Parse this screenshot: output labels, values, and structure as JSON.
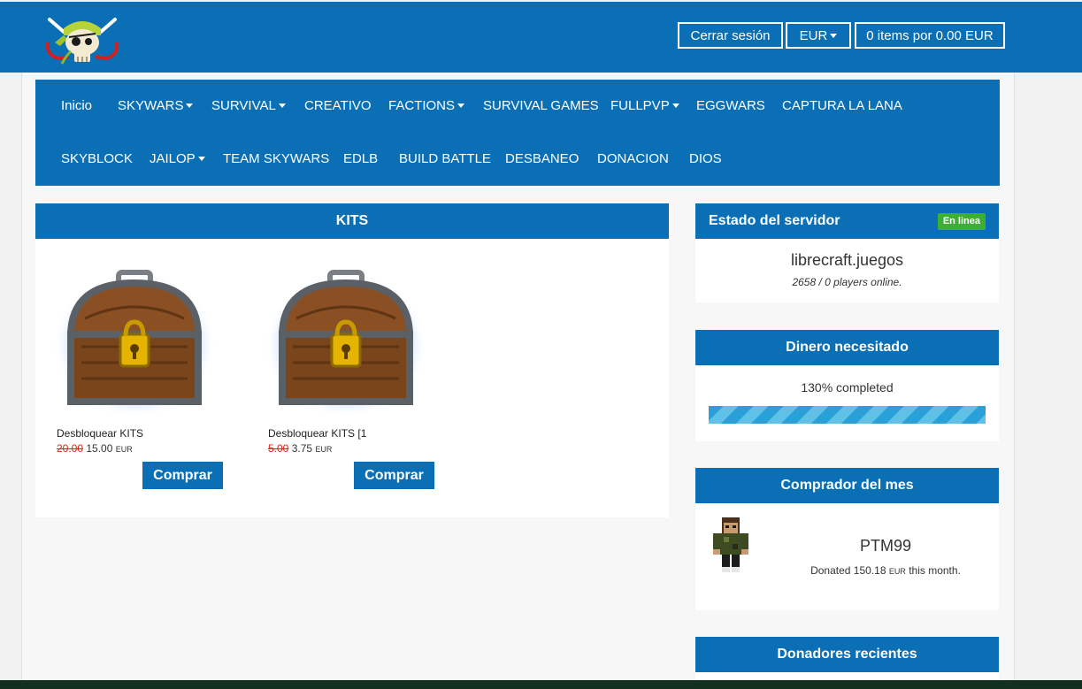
{
  "header": {
    "logout_label": "Cerrar sesión",
    "currency_label": "EUR",
    "cart_label": "0 items por 0.00 EUR"
  },
  "nav": {
    "items": [
      {
        "label": "Inicio",
        "dropdown": false
      },
      {
        "label": "SKYWARS",
        "dropdown": true
      },
      {
        "label": "SURVIVAL",
        "dropdown": true
      },
      {
        "label": "CREATIVO",
        "dropdown": false
      },
      {
        "label": "FACTIONS",
        "dropdown": true
      },
      {
        "label": "SURVIVAL GAMES",
        "dropdown": false
      },
      {
        "label": "FULLPVP",
        "dropdown": true
      },
      {
        "label": "EGGWARS",
        "dropdown": false
      },
      {
        "label": "CAPTURA LA LANA",
        "dropdown": false
      },
      {
        "label": "SKYBLOCK",
        "dropdown": false
      },
      {
        "label": "JAILOP",
        "dropdown": true
      },
      {
        "label": "TEAM SKYWARS",
        "dropdown": false
      },
      {
        "label": "EDLB",
        "dropdown": false
      },
      {
        "label": "BUILD BATTLE",
        "dropdown": false
      },
      {
        "label": "DESBANEO",
        "dropdown": false
      },
      {
        "label": "DONACION",
        "dropdown": false
      },
      {
        "label": "DIOS",
        "dropdown": false
      }
    ]
  },
  "kits": {
    "title": "KITS",
    "products": [
      {
        "name": "Desbloquear KITS",
        "old_price": "20.00",
        "price": "15.00",
        "currency": "EUR",
        "buy_label": "Comprar"
      },
      {
        "name": "Desbloquear KITS [1",
        "old_price": "5.00",
        "price": "3.75",
        "currency": "EUR",
        "buy_label": "Comprar"
      }
    ]
  },
  "server_status": {
    "title": "Estado del servidor",
    "badge": "En linea",
    "address": "librecraft.juegos",
    "players": "2658 / 0 players online."
  },
  "goal": {
    "title": "Dinero necesitado",
    "progress_text": "130% completed",
    "progress_percent": 100
  },
  "top_buyer": {
    "title": "Comprador del mes",
    "name": "PTM99",
    "donated_prefix": "Donated 150.18",
    "donated_currency": "EUR",
    "donated_suffix": "this month."
  },
  "recent": {
    "title": "Donadores recientes"
  },
  "colors": {
    "primary": "#0a6fb4",
    "online_badge": "#3cb035",
    "old_price": "#e02020"
  }
}
